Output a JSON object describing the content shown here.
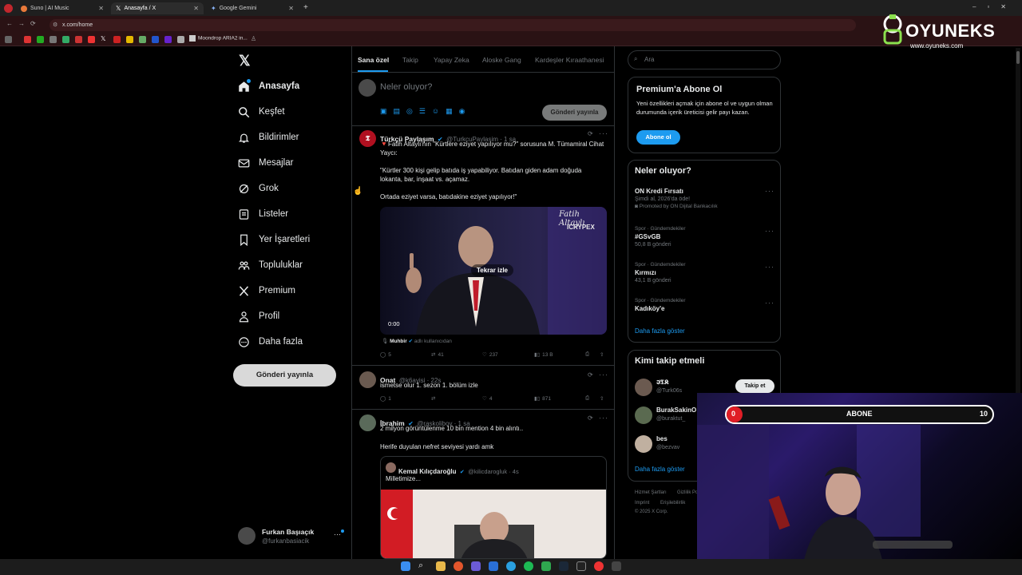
{
  "browser": {
    "tabs": [
      {
        "label": "Suno | AI Music"
      },
      {
        "label": "Anasayfa / X"
      },
      {
        "label": "Google Gemini"
      }
    ],
    "url": "x.com/home",
    "bookmark_label": "Moondrop ARIA2 in..."
  },
  "watermark": {
    "brand": "OYUNEKS",
    "url": "www.oyuneks.com"
  },
  "sidebar": {
    "items": [
      {
        "label": "Anasayfa",
        "icon": "home-icon"
      },
      {
        "label": "Keşfet",
        "icon": "search-icon"
      },
      {
        "label": "Bildirimler",
        "icon": "bell-icon"
      },
      {
        "label": "Mesajlar",
        "icon": "mail-icon"
      },
      {
        "label": "Grok",
        "icon": "grok-icon"
      },
      {
        "label": "Listeler",
        "icon": "list-icon"
      },
      {
        "label": "Yer İşaretleri",
        "icon": "bookmark-icon"
      },
      {
        "label": "Topluluklar",
        "icon": "communities-icon"
      },
      {
        "label": "Premium",
        "icon": "x-icon"
      },
      {
        "label": "Profil",
        "icon": "profile-icon"
      },
      {
        "label": "Daha fazla",
        "icon": "more-icon"
      }
    ],
    "post_button": "Gönderi yayınla",
    "user": {
      "name": "Furkan Başıaçık",
      "handle": "@furkanbasiacik"
    }
  },
  "feed": {
    "tabs": [
      "Sana özel",
      "Takip",
      "Yapay Zeka",
      "Aloske Gang",
      "Kardeşler Kıraathanesi"
    ],
    "compose_placeholder": "Neler oluyor?",
    "compose_button": "Gönderi yayınla",
    "posts": [
      {
        "name": "Türkçü Paylaşım",
        "handle": "@TurkcuPaylasim · 1 sa",
        "text1": "🔻Fatih Altaylı'nın \"Kürtlere eziyet yapılıyor mu?\" sorusuna M. Tümamiral Cihat Yaycı:",
        "text2": "\"Kürtler 300 kişi gelip batıda iş yapabiliyor. Batıdan giden adam doğuda lokanta, bar, inşaat vs. açamaz.",
        "text3": "Ortada eziyet varsa, batıdakine eziyet yapılıyor!\"",
        "video_overlay": "Tekrar izle",
        "video_time": "0:00",
        "video_brand": "Fatih Altaylı",
        "video_sponsor": "ICRYPEX",
        "attribution_name": "Muhbir",
        "attribution_suffix": "adlı kullanıcıdan",
        "stats": {
          "replies": "5",
          "reposts": "41",
          "likes": "237",
          "views": "13 B"
        }
      },
      {
        "name": "Onat",
        "handle": "@k6ayisi · 22s",
        "text1": "ismetse olur 1. sezon 1. bölüm izle",
        "stats": {
          "replies": "1",
          "reposts": "",
          "likes": "4",
          "views": "871"
        }
      },
      {
        "name": "İbrahim",
        "handle": "@raskolibov · 1 sa",
        "text1": "2 milyon görüntülenme 10 bin mention 4 bin alıntı..",
        "text2": "Herife duyulan nefret seviyesi yardı amk",
        "quote": {
          "name": "Kemal Kılıçdaroğlu",
          "handle": "@kilicdarogluk · 4s",
          "text": "Milletimize..."
        }
      }
    ]
  },
  "right": {
    "search_placeholder": "Ara",
    "premium": {
      "title": "Premium'a Abone Ol",
      "text": "Yeni özellikleri açmak için abone ol ve uygun olman durumunda içerik üreticisi gelir payı kazan.",
      "button": "Abone ol"
    },
    "trends": {
      "title": "Neler oluyor?",
      "items": [
        {
          "context": "",
          "title": "ON Kredi Fırsatı",
          "sub": "Şimdi al, 2026'da öde!",
          "promo": "Promoted by ON Dijital Bankacılık"
        },
        {
          "context": "Spor · Gündemdekiler",
          "title": "#GSvGB",
          "sub": "50,8 B gönderi"
        },
        {
          "context": "Spor · Gündemdekiler",
          "title": "Kırmızı",
          "sub": "43,1 B gönderi"
        },
        {
          "context": "Spor · Gündemdekiler",
          "title": "Kadıköy'e",
          "sub": ""
        }
      ],
      "more": "Daha fazla göster"
    },
    "who_to_follow": {
      "title": "Kimi takip etmeli",
      "users": [
        {
          "name": "𝕴𝕿𝕶",
          "handle": "@Turk06s",
          "button": "Takip et"
        },
        {
          "name": "BurakSakinO",
          "handle": "@buraktut_"
        },
        {
          "name": "bes",
          "handle": "@bezvav"
        }
      ],
      "more": "Daha fazla göster"
    },
    "footer": [
      "Hizmet Şartları",
      "Gizlilik Po",
      "Imprint",
      "Erişilebilirlik",
      "© 2025 X Corp."
    ]
  },
  "overlay": {
    "progress_current": "0",
    "progress_label": "ABONE",
    "progress_target": "10"
  }
}
